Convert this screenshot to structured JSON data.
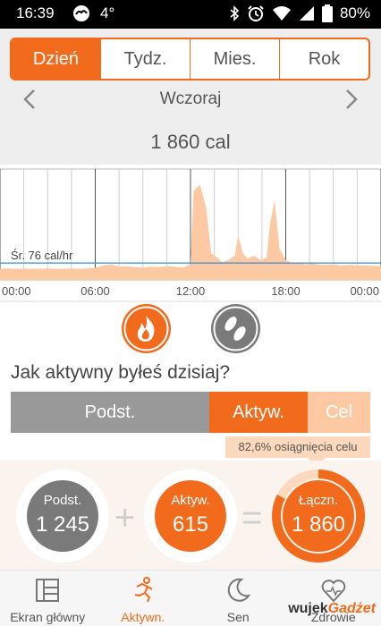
{
  "status": {
    "time": "16:39",
    "temperature": "4°",
    "battery": "80%",
    "icons": [
      "weather-icon",
      "bluetooth-icon",
      "alarm-icon",
      "wifi-icon",
      "signal-icon",
      "battery-icon"
    ]
  },
  "tabs": [
    {
      "label": "Dzień",
      "active": true
    },
    {
      "label": "Tydz.",
      "active": false
    },
    {
      "label": "Mies.",
      "active": false
    },
    {
      "label": "Rok",
      "active": false
    }
  ],
  "nav": {
    "day_label": "Wczoraj"
  },
  "summary": {
    "total": "1 860 cal"
  },
  "chart_data": {
    "type": "area",
    "x_ticks": [
      "00:00",
      "06:00",
      "12:00",
      "18:00",
      "00:00"
    ],
    "x_range": [
      0,
      24
    ],
    "average_label": "Śr. 76 cal/hr",
    "average_value": 76,
    "y_range": [
      0,
      500
    ],
    "grid": true,
    "x": [
      0,
      0.5,
      1,
      1.5,
      2,
      2.5,
      3,
      3.5,
      4,
      4.5,
      5,
      5.5,
      6,
      6.5,
      7,
      7.5,
      8,
      8.5,
      9,
      9.5,
      10,
      10.5,
      11,
      11.5,
      12,
      12.2,
      12.6,
      13,
      13.3,
      13.7,
      14,
      14.4,
      14.8,
      15,
      15.3,
      15.6,
      16,
      16.4,
      16.8,
      17,
      17.3,
      17.6,
      18,
      18.4,
      18.8,
      19.2,
      19.6,
      20,
      20.5,
      21,
      21.5,
      22,
      22.5,
      23,
      23.5,
      24
    ],
    "y": [
      50,
      52,
      49,
      51,
      50,
      50,
      52,
      49,
      50,
      51,
      50,
      52,
      55,
      65,
      70,
      60,
      62,
      58,
      55,
      60,
      58,
      62,
      60,
      55,
      70,
      400,
      430,
      320,
      120,
      100,
      80,
      90,
      110,
      200,
      120,
      95,
      110,
      90,
      100,
      250,
      360,
      140,
      90,
      75,
      80,
      70,
      75,
      70,
      68,
      70,
      65,
      68,
      66,
      65,
      64,
      62
    ],
    "series_color": "#fcc9a3",
    "average_color": "#3a8fd6"
  },
  "toggle_icons": {
    "fire": "fire-icon",
    "steps": "footsteps-icon"
  },
  "question": "Jak aktywny byłeś dzisiaj?",
  "activity_bar": {
    "basic_label": "Podst.",
    "active_label": "Aktyw.",
    "goal_label": "Cel",
    "tooltip": "82,6% osiągnięcia celu",
    "colors": {
      "basic": "#999999",
      "active": "#f26a1b",
      "goal": "#fcc9a3"
    }
  },
  "rings": {
    "basic": {
      "label": "Podst.",
      "value": "1 245"
    },
    "active": {
      "label": "Aktyw.",
      "value": "615"
    },
    "total": {
      "label": "Łączn.",
      "value": "1 860",
      "progress": 0.826
    },
    "plus": "+",
    "equals": "="
  },
  "bottom_nav": [
    {
      "label": "Ekran główny",
      "icon": "home-screen-icon",
      "active": false
    },
    {
      "label": "Aktywn.",
      "icon": "running-icon",
      "active": true
    },
    {
      "label": "Sen",
      "icon": "moon-icon",
      "active": false
    },
    {
      "label": "Zdrowie",
      "icon": "heart-icon",
      "active": false
    }
  ],
  "watermark": {
    "pre": "wujek",
    "brand": "Gadżet"
  }
}
